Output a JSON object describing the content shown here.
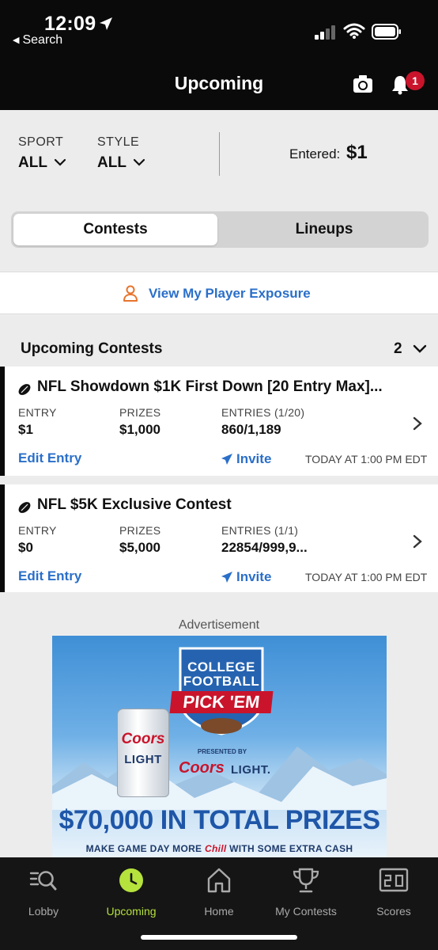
{
  "status_bar": {
    "time": "12:09",
    "back_label": "Search"
  },
  "header": {
    "title": "Upcoming",
    "notification_count": "1"
  },
  "filters": {
    "sport_label": "SPORT",
    "sport_value": "ALL",
    "style_label": "STYLE",
    "style_value": "ALL",
    "entered_label": "Entered:",
    "entered_value": "$1"
  },
  "toggle": {
    "contests": "Contests",
    "lineups": "Lineups",
    "selected": "Contests"
  },
  "exposure_link": "View My Player Exposure",
  "section": {
    "title": "Upcoming Contests",
    "count": "2"
  },
  "contests": [
    {
      "title": "NFL Showdown $1K First Down [20 Entry Max]...",
      "entry_label": "ENTRY",
      "entry_value": "$1",
      "prizes_label": "PRIZES",
      "prizes_value": "$1,000",
      "entries_label": "ENTRIES (1/20)",
      "entries_value": "860/1,189",
      "edit_label": "Edit Entry",
      "invite_label": "Invite",
      "time": "TODAY AT 1:00 PM EDT"
    },
    {
      "title": "NFL $5K Exclusive Contest",
      "entry_label": "ENTRY",
      "entry_value": "$0",
      "prizes_label": "PRIZES",
      "prizes_value": "$5,000",
      "entries_label": "ENTRIES (1/1)",
      "entries_value": "22854/999,9...",
      "edit_label": "Edit Entry",
      "invite_label": "Invite",
      "time": "TODAY AT 1:00 PM EDT"
    }
  ],
  "ad": {
    "label": "Advertisement",
    "line1": "COLLEGE",
    "line2": "FOOTBALL",
    "line3": "PICK 'EM",
    "presented_by": "PRESENTED BY",
    "brand": "Coors",
    "brand_light": "LIGHT.",
    "can_brand": "Coors",
    "can_light": "LIGHT",
    "headline": "$70,000 IN TOTAL PRIZES",
    "sub_pre": "MAKE GAME DAY MORE",
    "sub_chill": "Chill",
    "sub_post": "WITH SOME EXTRA CASH"
  },
  "tabs": [
    {
      "label": "Lobby",
      "icon": "lobby-search-icon"
    },
    {
      "label": "Upcoming",
      "icon": "clock-icon",
      "active": true
    },
    {
      "label": "Home",
      "icon": "home-icon"
    },
    {
      "label": "My Contests",
      "icon": "trophy-icon"
    },
    {
      "label": "Scores",
      "icon": "scoreboard-icon"
    }
  ],
  "colors": {
    "accent_blue": "#2a6fc9",
    "active_green": "#b5e23c",
    "badge_red": "#c9142b",
    "header_bg": "#0a0a0a"
  }
}
